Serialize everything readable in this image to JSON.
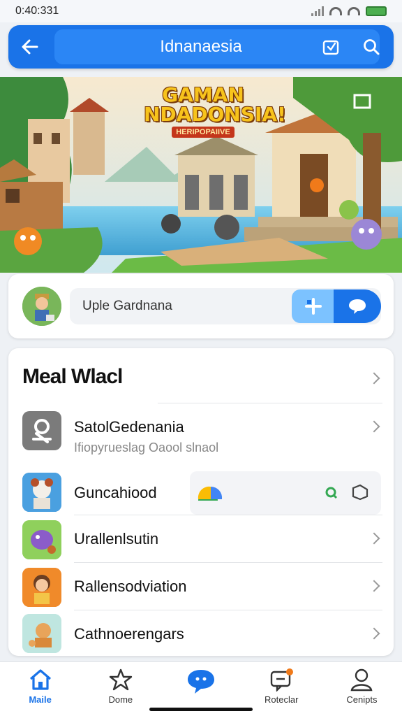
{
  "status": {
    "time": "0:40:331"
  },
  "header": {
    "title": "Idnanaesia",
    "icons": [
      "back-arrow-icon",
      "share-icon",
      "search-icon"
    ]
  },
  "banner": {
    "logo_title_line1": "GAMAN",
    "logo_title_line2": "NDADONSIA!",
    "logo_subtitle": "HERIPOPAIIVE"
  },
  "user": {
    "name": "Uple Gardnana"
  },
  "list": {
    "header": "Meal Wlacl",
    "items": [
      {
        "title": "SatolGedenania",
        "subtitle": "Ifiopyrueslag Oaool slnaol",
        "icon": "puzzle-icon"
      },
      {
        "title": "Guncahiood",
        "icon": "character-thumbnail"
      },
      {
        "title": "Urallenlsutin",
        "icon": "monster-thumbnail"
      },
      {
        "title": "Rallensodviation",
        "icon": "character-thumbnail"
      },
      {
        "title": "Cathnoerengars",
        "icon": "character-thumbnail"
      }
    ]
  },
  "nav": {
    "items": [
      {
        "label": "Maile",
        "icon": "home-icon",
        "active": true
      },
      {
        "label": "Dome",
        "icon": "star-icon",
        "active": false
      },
      {
        "label": "",
        "icon": "chat-icon",
        "active": false
      },
      {
        "label": "Roteclar",
        "icon": "notification-icon",
        "active": false
      },
      {
        "label": "Cenipts",
        "icon": "profile-icon",
        "active": false
      }
    ]
  },
  "colors": {
    "primary": "#1a73e8",
    "accent_light": "#7cc2ff",
    "background": "#eef1f5",
    "card": "#ffffff"
  }
}
